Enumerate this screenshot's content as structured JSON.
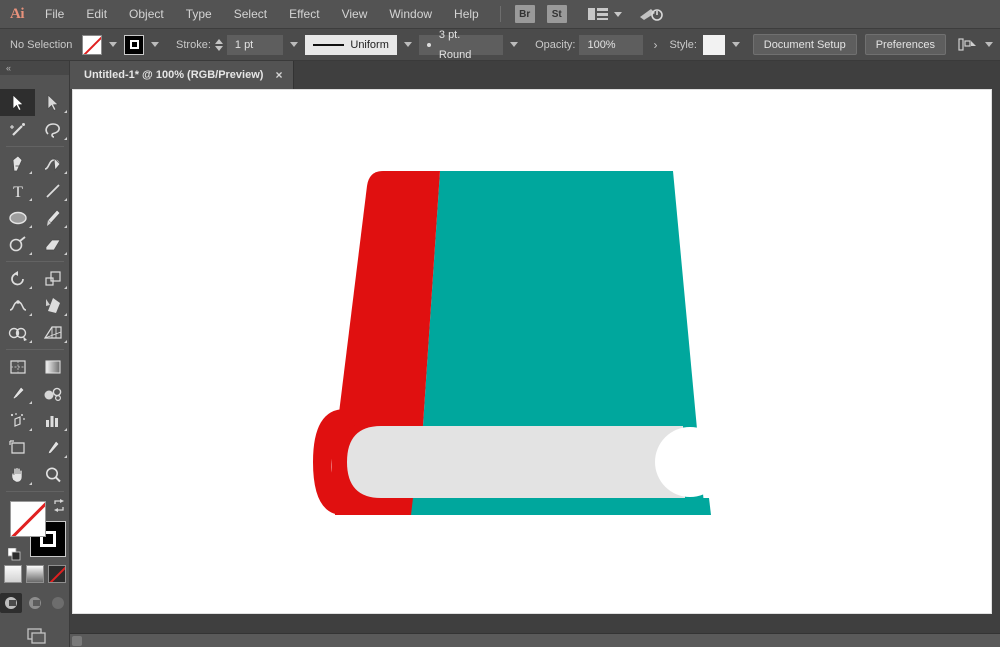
{
  "app": {
    "name": "Adobe Illustrator",
    "logo_text": "Ai"
  },
  "menubar": {
    "items": [
      {
        "label": "File"
      },
      {
        "label": "Edit"
      },
      {
        "label": "Object"
      },
      {
        "label": "Type"
      },
      {
        "label": "Select"
      },
      {
        "label": "Effect"
      },
      {
        "label": "View"
      },
      {
        "label": "Window"
      },
      {
        "label": "Help"
      }
    ],
    "bridge_label": "Br",
    "stock_label": "St",
    "workspace_icon": "workspace-switcher-icon",
    "help_icon": "search-help-icon"
  },
  "controlbar": {
    "selection_status": "No Selection",
    "fill_swatch": "none",
    "stroke_swatch": "black",
    "stroke_label": "Stroke:",
    "stroke_weight": "1 pt",
    "stroke_profile": "Uniform",
    "brush_definition": "3 pt. Round",
    "opacity_label": "Opacity:",
    "opacity_value": "100%",
    "opacity_more": "›",
    "style_label": "Style:",
    "document_setup_label": "Document Setup",
    "preferences_label": "Preferences",
    "align_icon": "align-to-artboard-icon"
  },
  "tabs": [
    {
      "title": "Untitled-1* @ 100% (RGB/Preview)",
      "close_label": "×",
      "active": true
    }
  ],
  "toolbar": {
    "collapse_label": "«",
    "tools": [
      {
        "name": "selection-tool",
        "active": true
      },
      {
        "name": "direct-selection-tool",
        "active": false
      },
      {
        "name": "magic-wand-tool",
        "active": false
      },
      {
        "name": "lasso-tool",
        "active": false
      },
      {
        "name": "pen-tool",
        "active": false
      },
      {
        "name": "curvature-tool",
        "active": false
      },
      {
        "name": "type-tool",
        "active": false
      },
      {
        "name": "line-segment-tool",
        "active": false
      },
      {
        "name": "ellipse-tool",
        "active": false
      },
      {
        "name": "paintbrush-tool",
        "active": false
      },
      {
        "name": "shaper-tool",
        "active": false
      },
      {
        "name": "eraser-tool",
        "active": false
      },
      {
        "name": "rotate-tool",
        "active": false
      },
      {
        "name": "scale-tool",
        "active": false
      },
      {
        "name": "width-tool",
        "active": false
      },
      {
        "name": "free-transform-tool",
        "active": false
      },
      {
        "name": "shape-builder-tool",
        "active": false
      },
      {
        "name": "perspective-grid-tool",
        "active": false
      },
      {
        "name": "mesh-tool",
        "active": false
      },
      {
        "name": "gradient-tool",
        "active": false
      },
      {
        "name": "eyedropper-tool",
        "active": false
      },
      {
        "name": "blend-tool",
        "active": false
      },
      {
        "name": "symbol-sprayer-tool",
        "active": false
      },
      {
        "name": "column-graph-tool",
        "active": false
      },
      {
        "name": "artboard-tool",
        "active": false
      },
      {
        "name": "slice-tool",
        "active": false
      },
      {
        "name": "hand-tool",
        "active": false
      },
      {
        "name": "zoom-tool",
        "active": false
      }
    ],
    "fill_state": "none",
    "stroke_state": "black",
    "swap_icon": "swap-fill-stroke-icon",
    "default_icon": "default-fill-stroke-icon",
    "color_modes": [
      {
        "name": "color-mode-button",
        "active": false
      },
      {
        "name": "gradient-mode-button",
        "active": false
      },
      {
        "name": "none-mode-button",
        "active": false
      }
    ],
    "screen_modes": [
      {
        "name": "normal-screen-mode-button",
        "active": true
      },
      {
        "name": "fullscreen-menubar-mode-button",
        "active": false
      },
      {
        "name": "fullscreen-mode-button",
        "active": false
      }
    ],
    "change_screen_mode_icon": "change-screen-mode-icon"
  },
  "artwork": {
    "name": "book-illustration",
    "colors": {
      "spine_red": "#E01010",
      "cover_teal": "#00A79D",
      "pages_gray": "#E3E3E3",
      "page_notch": "#FFFFFF",
      "artboard_bg": "#FFFFFF"
    }
  },
  "canvas": {
    "background": "#3F3F3F",
    "zoom_level": "100%"
  }
}
